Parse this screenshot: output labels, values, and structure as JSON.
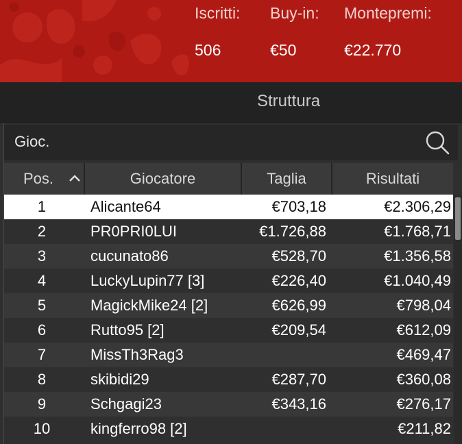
{
  "header": {
    "stats": [
      {
        "label": "Iscritti:",
        "value": "506"
      },
      {
        "label": "Buy-in:",
        "value": "€50"
      },
      {
        "label": "Montepremi:",
        "value": "€22.770"
      }
    ]
  },
  "tabs": {
    "active": "Struttura"
  },
  "search": {
    "label": "Gioc.",
    "icon": "search-icon"
  },
  "table": {
    "columns": [
      "Pos.",
      "Giocatore",
      "Taglia",
      "Risultati"
    ],
    "sort_icon": "chevron-up-icon",
    "rows": [
      {
        "pos": "1",
        "player": "Alicante64",
        "stack": "€703,18",
        "result": "€2.306,29"
      },
      {
        "pos": "2",
        "player": "PR0PRI0LUI",
        "stack": "€1.726,88",
        "result": "€1.768,71"
      },
      {
        "pos": "3",
        "player": "cucunato86",
        "stack": "€528,70",
        "result": "€1.356,58"
      },
      {
        "pos": "4",
        "player": "LuckyLupin77 [3]",
        "stack": "€226,40",
        "result": "€1.040,49"
      },
      {
        "pos": "5",
        "player": "MagickMike24 [2]",
        "stack": "€626,99",
        "result": "€798,04"
      },
      {
        "pos": "6",
        "player": "Rutto95 [2]",
        "stack": "€209,54",
        "result": "€612,09"
      },
      {
        "pos": "7",
        "player": "MissTh3Rag3",
        "stack": "",
        "result": "€469,47"
      },
      {
        "pos": "8",
        "player": "skibidi29",
        "stack": "€287,70",
        "result": "€360,08"
      },
      {
        "pos": "9",
        "player": "Schgagi23",
        "stack": "€343,16",
        "result": "€276,17"
      },
      {
        "pos": "10",
        "player": "kingferro98 [2]",
        "stack": "",
        "result": "€211,82"
      }
    ]
  },
  "colors": {
    "banner": "#b01a14",
    "selected_row": "#ffffff",
    "row_alt": "#383838"
  }
}
